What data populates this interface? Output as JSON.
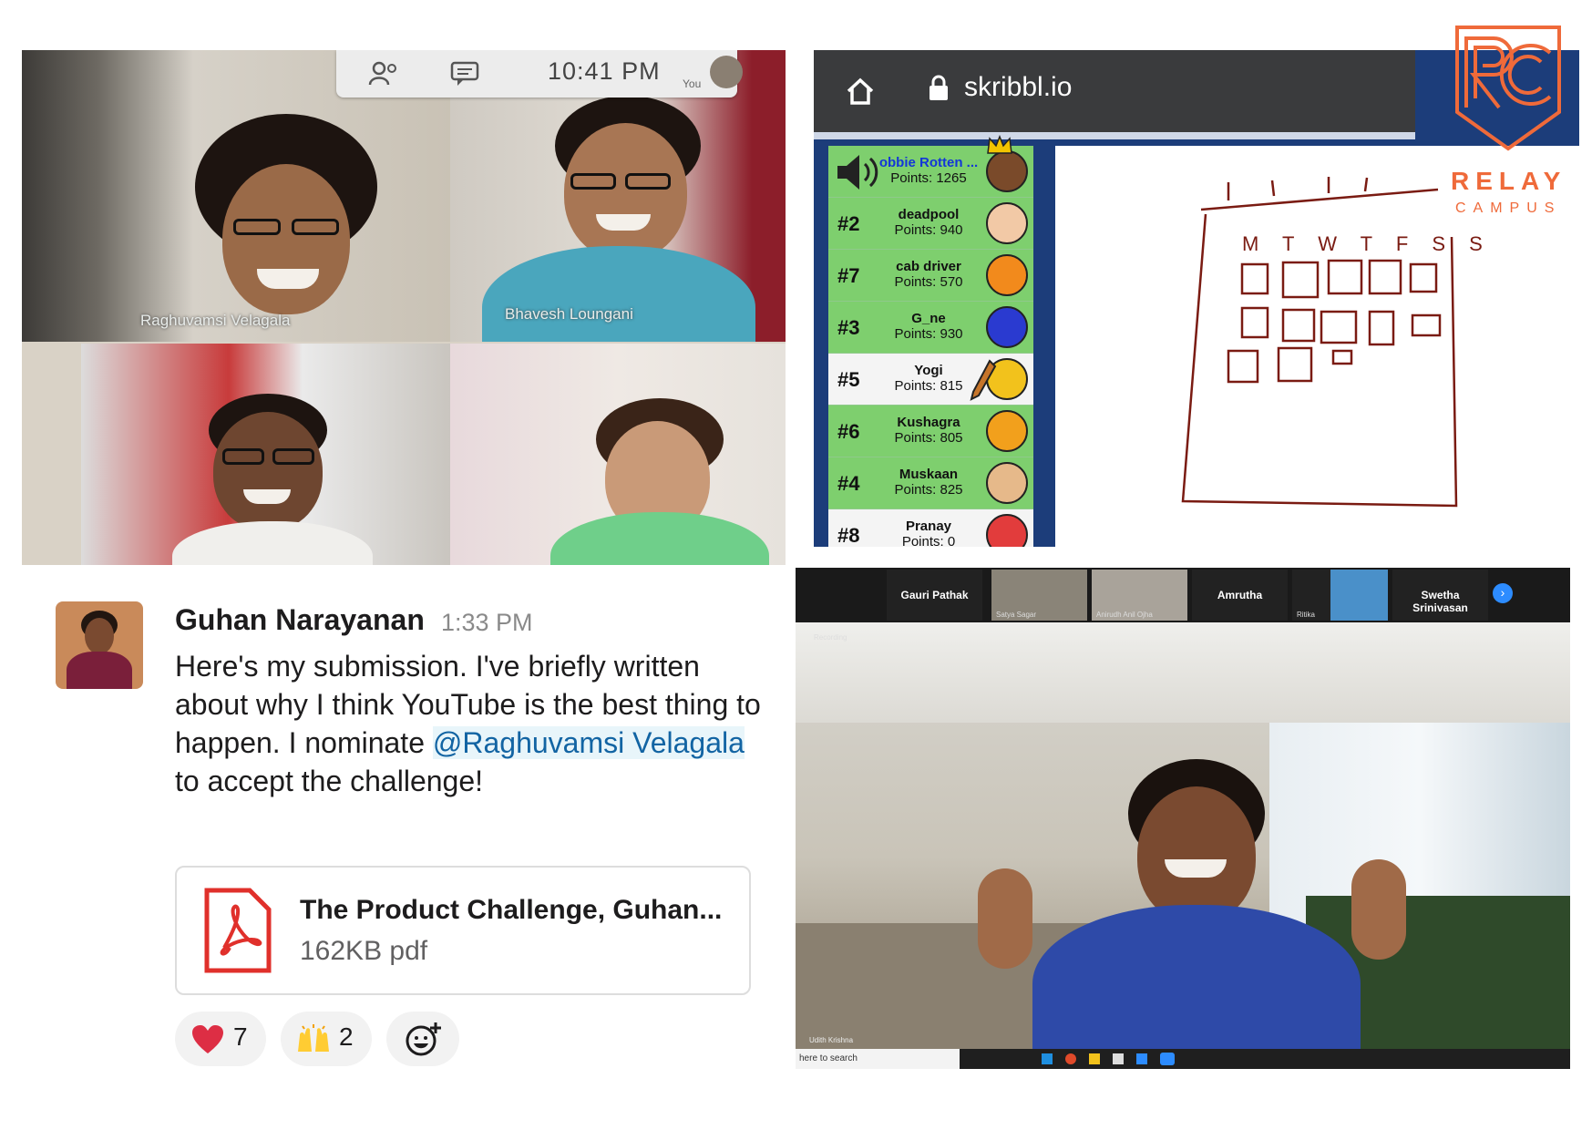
{
  "video_call": {
    "time": "10:41 PM",
    "you_label": "You",
    "participants": [
      {
        "name": "Raghuvamsi Velagala"
      },
      {
        "name": "Bhavesh Loungani"
      }
    ]
  },
  "skribbl": {
    "url": "skribbl.io",
    "players": [
      {
        "rank": "",
        "name": "obbie Rotten ...",
        "points": "Points: 1265",
        "avatar_color": "#7a4a2a"
      },
      {
        "rank": "#2",
        "name": "deadpool",
        "points": "Points: 940",
        "avatar_color": "#f2c9a6"
      },
      {
        "rank": "#7",
        "name": "cab driver",
        "points": "Points: 570",
        "avatar_color": "#f28a1c"
      },
      {
        "rank": "#3",
        "name": "G_ne",
        "points": "Points: 930",
        "avatar_color": "#2a3ad0"
      },
      {
        "rank": "#5",
        "name": "Yogi",
        "points": "Points: 815",
        "avatar_color": "#f2c21c"
      },
      {
        "rank": "#6",
        "name": "Kushagra",
        "points": "Points: 805",
        "avatar_color": "#f2a01c"
      },
      {
        "rank": "#4",
        "name": "Muskaan",
        "points": "Points: 825",
        "avatar_color": "#e6b98a"
      },
      {
        "rank": "#8",
        "name": "Pranay",
        "points": "Points: 0",
        "avatar_color": "#e23c3c"
      }
    ],
    "drawing_letters": "M T W T F S S"
  },
  "logo": {
    "line1": "RELAY",
    "line2": "CAMPUS"
  },
  "slack": {
    "author": "Guhan Narayanan",
    "time": "1:33 PM",
    "text_before": "Here's my submission. I've briefly written about why I think YouTube is the best thing to happen. I nominate ",
    "mention": "@Raghuvamsi Velagala",
    "text_after": " to accept the challenge!",
    "file": {
      "name": "The Product Challenge, Guhan...",
      "meta": "162KB pdf"
    },
    "reactions": [
      {
        "emoji": "heart",
        "count": "7"
      },
      {
        "emoji": "raised-hands",
        "count": "2"
      }
    ]
  },
  "zoom": {
    "participants": [
      {
        "name": "Gauri Pathak"
      },
      {
        "name": "Satya Sagar"
      },
      {
        "name": "Anirudh Anil Ojha"
      },
      {
        "name": "Amrutha"
      },
      {
        "name": "Ritika"
      },
      {
        "name": "Swetha Srinivasan"
      }
    ],
    "recording_label": "Recording",
    "speaker": "Udith Krishna",
    "taskbar_search": "here to search"
  }
}
